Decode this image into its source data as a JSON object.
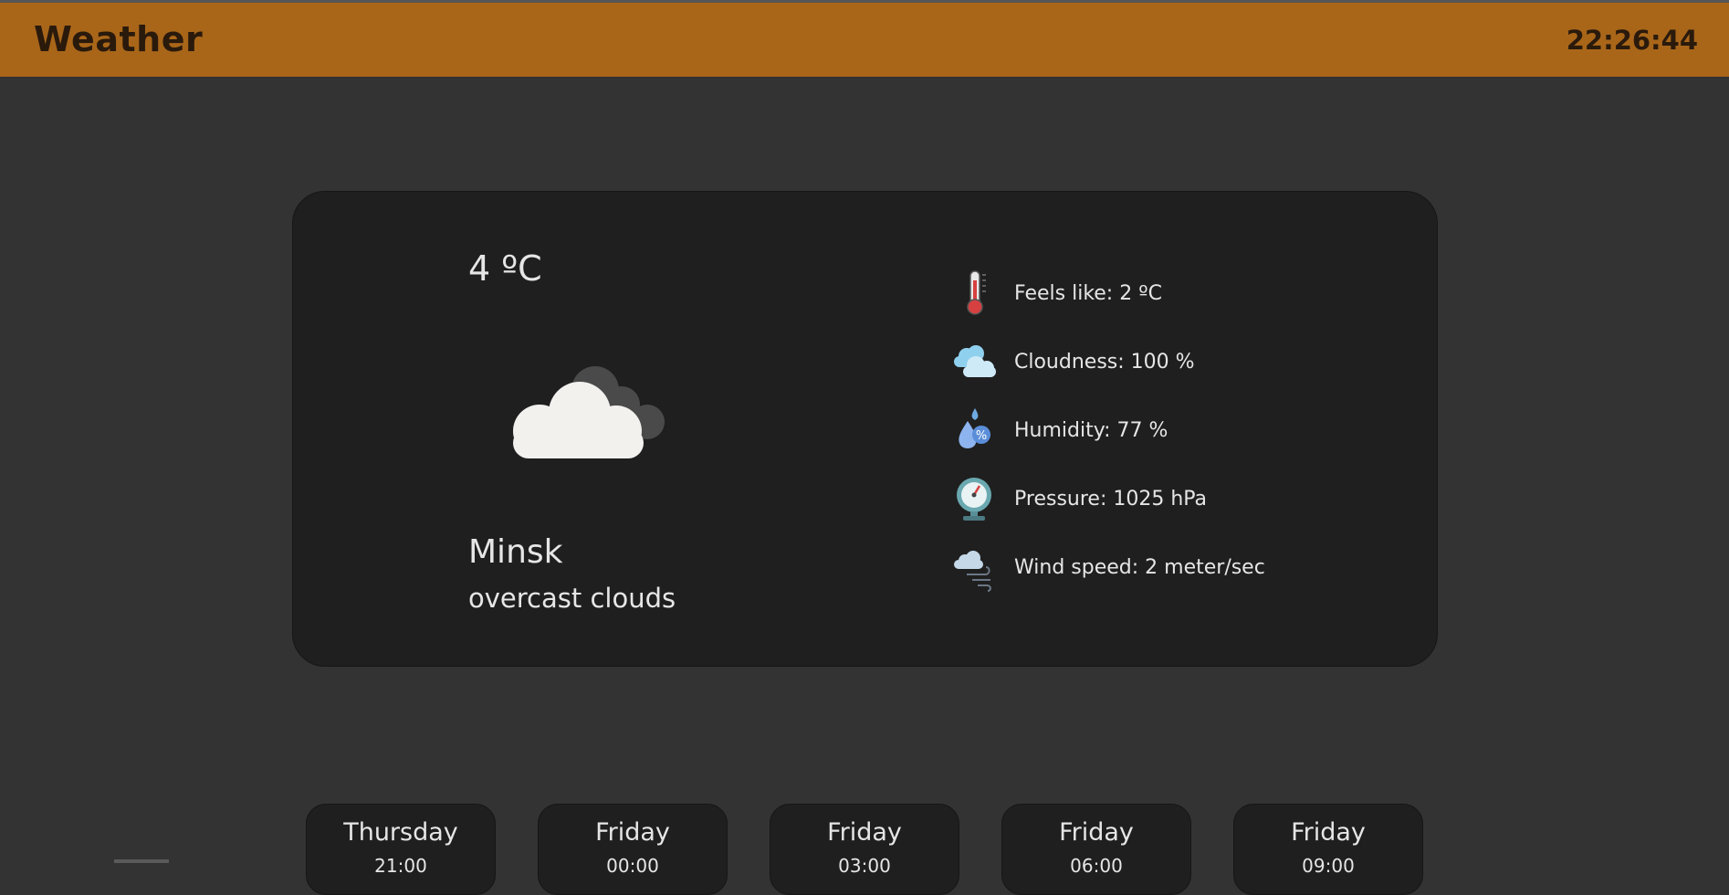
{
  "header": {
    "title": "Weather",
    "clock": "22:26:44",
    "accent_color": "#a96619"
  },
  "current": {
    "temperature": "4 ºC",
    "icon": "overcast-clouds-icon",
    "city": "Minsk",
    "description": "overcast clouds"
  },
  "details": [
    {
      "icon": "thermometer-icon",
      "text": "Feels like: 2 ºC"
    },
    {
      "icon": "cloudness-icon",
      "text": "Cloudness: 100 %"
    },
    {
      "icon": "humidity-icon",
      "text": "Humidity: 77 %"
    },
    {
      "icon": "pressure-gauge-icon",
      "text": "Pressure: 1025 hPa"
    },
    {
      "icon": "wind-icon",
      "text": "Wind speed: 2 meter/sec"
    }
  ],
  "forecast": [
    {
      "day": "Thursday",
      "time": "21:00"
    },
    {
      "day": "Friday",
      "time": "00:00"
    },
    {
      "day": "Friday",
      "time": "03:00"
    },
    {
      "day": "Friday",
      "time": "06:00"
    },
    {
      "day": "Friday",
      "time": "09:00"
    }
  ]
}
